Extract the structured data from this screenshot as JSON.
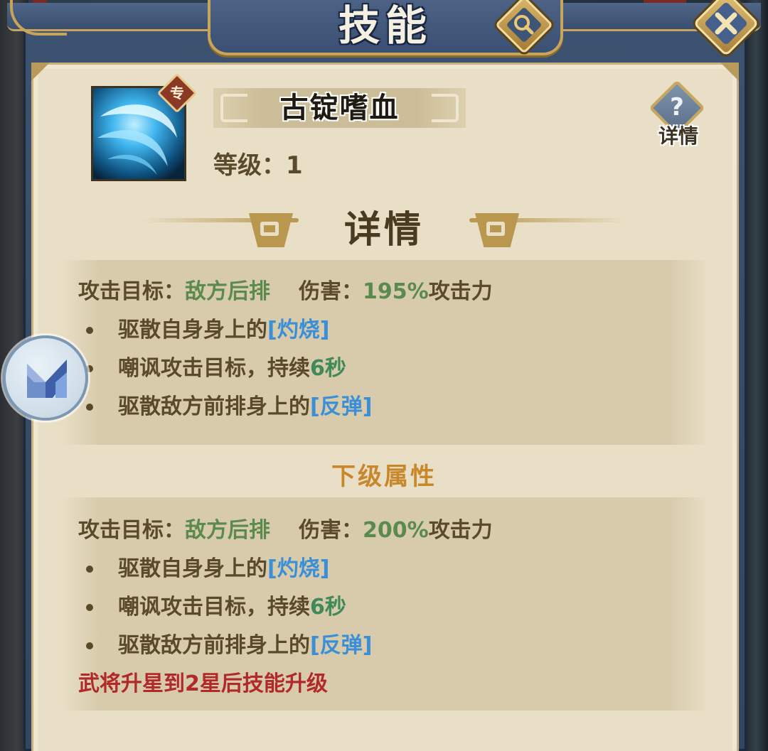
{
  "header": {
    "title": "技能"
  },
  "skill": {
    "badge": "专",
    "name": "古锭嗜血",
    "level_label": "等级：",
    "level_value": "1"
  },
  "detail_button": {
    "symbol": "?",
    "label": "详情"
  },
  "section_title": "详情",
  "current": {
    "target_label": "攻击目标：",
    "target_value": "敌方后排",
    "damage_label": "伤害：",
    "damage_value": "195%",
    "damage_suffix": "攻击力",
    "effects": [
      {
        "text": "驱散自身身上的",
        "highlight": "[灼烧]",
        "suffix": ""
      },
      {
        "text": "嘲讽攻击目标，持续",
        "highlight": "6秒",
        "suffix": ""
      },
      {
        "text": "驱散敌方前排身上的",
        "highlight": "[反弹]",
        "suffix": ""
      }
    ]
  },
  "next_level_title": "下级属性",
  "next": {
    "target_label": "攻击目标：",
    "target_value": "敌方后排",
    "damage_label": "伤害：",
    "damage_value": "200%",
    "damage_suffix": "攻击力",
    "effects": [
      {
        "text": "驱散自身身上的",
        "highlight": "[灼烧]",
        "suffix": ""
      },
      {
        "text": "嘲讽攻击目标，持续",
        "highlight": "6秒",
        "suffix": ""
      },
      {
        "text": "驱散敌方前排身上的",
        "highlight": "[反弹]",
        "suffix": ""
      }
    ],
    "upgrade_note": "武将升星到2星后技能升级"
  },
  "colors": {
    "parchment": "#e8dfc6",
    "frame_blue": "#3d5270",
    "gold": "#c9a55c",
    "text_brown": "#5b4a2a",
    "green_value": "#5a8a4e",
    "blue_keyword": "#3a8fd6",
    "orange_heading": "#c8872a",
    "red_note": "#b02a2a"
  },
  "icons": {
    "search": "magnifier-icon",
    "close": "close-x-icon",
    "skill": "blue-slash-skill-icon",
    "help": "question-icon",
    "assistant": "floating-assistant-logo-icon"
  }
}
